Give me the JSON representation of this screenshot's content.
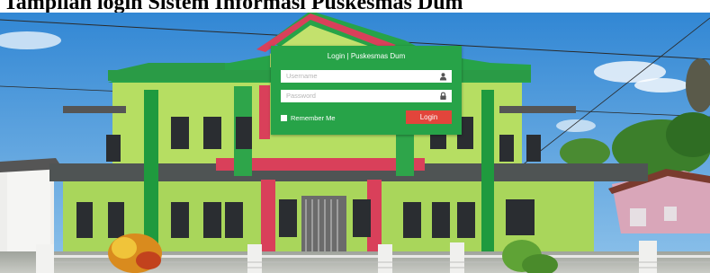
{
  "caption": {
    "text": "Tampilan login Sistem Informasi Puskesmas Dum"
  },
  "login": {
    "title": "Login | Puskesmas Dum",
    "username": {
      "value": "",
      "placeholder": "Username",
      "icon": "user-icon"
    },
    "password": {
      "value": "",
      "placeholder": "Password",
      "icon": "lock-icon"
    },
    "remember_label": "Remember Me",
    "remember_checked": false,
    "button_label": "Login"
  },
  "colors": {
    "card": "#27a348",
    "button": "#e2453b",
    "building_green": "#a9d65b",
    "building_dark_green": "#1f9a3e",
    "building_red": "#d9405a",
    "sky": "#3b8fd6"
  }
}
